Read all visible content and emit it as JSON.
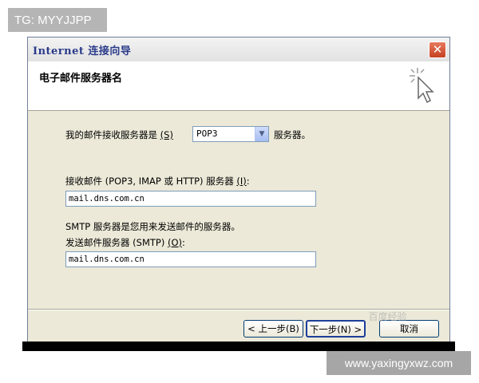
{
  "overlay": {
    "tg_label": "TG: MYYJJPP",
    "url_label": "www.yaxingyxwz.com"
  },
  "window": {
    "title": "Internet 连接向导",
    "close_glyph": "✕"
  },
  "header": {
    "title": "电子邮件服务器名",
    "icon": "wizard-cursor-icon"
  },
  "form": {
    "incoming_type_prefix": "我的邮件接收服务器是",
    "incoming_type_hotkey": "(S)",
    "incoming_type_value": "POP3",
    "incoming_type_suffix": "服务器。",
    "incoming_server_label": "接收邮件 (POP3, IMAP 或 HTTP) 服务器",
    "incoming_server_hotkey": "(I)",
    "incoming_server_colon": ":",
    "incoming_server_value": "mail.dns.com.cn",
    "smtp_note": "SMTP 服务器是您用来发送邮件的服务器。",
    "outgoing_server_label": "发送邮件服务器 (SMTP)",
    "outgoing_server_hotkey": "(O)",
    "outgoing_server_colon": ":",
    "outgoing_server_value": "mail.dns.com.cn"
  },
  "buttons": {
    "back": "< 上一步(B)",
    "next": "下一步(N) >",
    "cancel": "取消"
  },
  "watermark": "百度经验"
}
